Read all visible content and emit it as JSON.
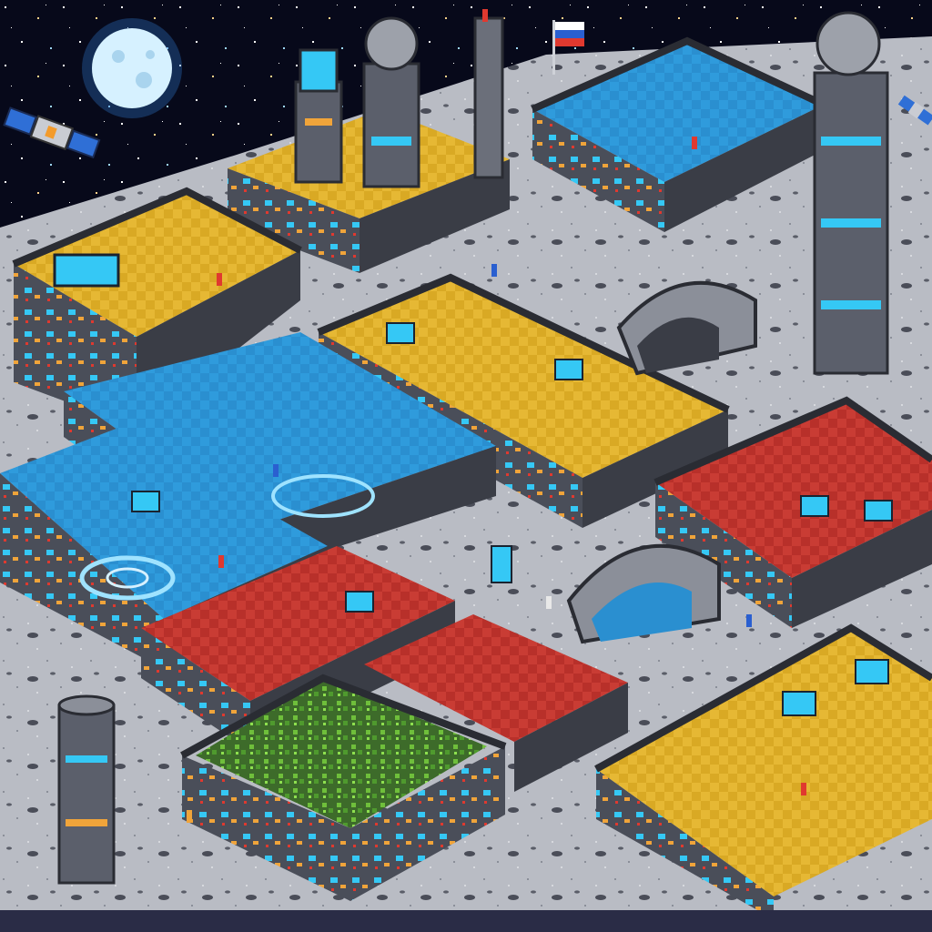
{
  "scene": {
    "colors": {
      "space": "#07091a",
      "ground": "#b9bcc4",
      "ground_dark": "#8b8f99",
      "crater": "#4a4d58",
      "wall_top": "#3a3d46",
      "wall_side": "#5b5f6b",
      "blue_room": "#2a8fd0",
      "yellow_room": "#e0b22a",
      "red_room": "#c9342c",
      "screen": "#35c8f5",
      "plants": "#4f9a2e",
      "moon": "#d6f1ff"
    },
    "rooms": [
      {
        "id": "upper-left-yellow",
        "theme": "yellow"
      },
      {
        "id": "top-center-yellow",
        "theme": "yellow"
      },
      {
        "id": "top-right-blue",
        "theme": "blue"
      },
      {
        "id": "center-blue-control",
        "theme": "blue"
      },
      {
        "id": "center-yellow-lab",
        "theme": "yellow"
      },
      {
        "id": "left-blue-hub",
        "theme": "blue"
      },
      {
        "id": "right-red-command",
        "theme": "red"
      },
      {
        "id": "lower-red-workshop",
        "theme": "red"
      },
      {
        "id": "lower-red-office",
        "theme": "red"
      },
      {
        "id": "greenhouse",
        "theme": "green"
      },
      {
        "id": "lower-right-yellow",
        "theme": "yellow"
      }
    ],
    "structures": [
      "tower-top-left",
      "tower-top-center",
      "tower-right",
      "silo-lower-left",
      "tunnel-upper",
      "tunnel-lower"
    ],
    "decor": [
      "moon",
      "satellite-left",
      "satellite-right",
      "flag",
      "stars"
    ]
  }
}
